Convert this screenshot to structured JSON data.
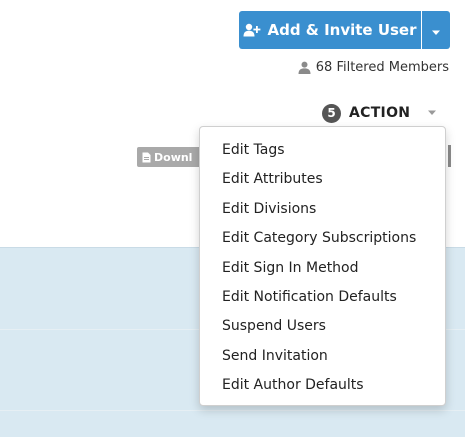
{
  "header": {
    "add_invite_label": "Add & Invite User",
    "filtered_members": "68 Filtered Members"
  },
  "action": {
    "count": "5",
    "label": "ACTION"
  },
  "download": {
    "label": "Downl"
  },
  "menu": {
    "items": [
      "Edit Tags",
      "Edit Attributes",
      "Edit Divisions",
      "Edit Category Subscriptions",
      "Edit Sign In Method",
      "Edit Notification Defaults",
      "Suspend Users",
      "Send Invitation",
      "Edit Author Defaults"
    ]
  },
  "colors": {
    "primary": "#3a8fcf",
    "row_background": "#d9e9f2",
    "badge": "#555555",
    "download_button": "#a9a9a9"
  },
  "icons": {
    "add_user": "user-plus-icon",
    "members": "user-icon",
    "download": "file-icon",
    "caret": "chevron-down-icon"
  }
}
